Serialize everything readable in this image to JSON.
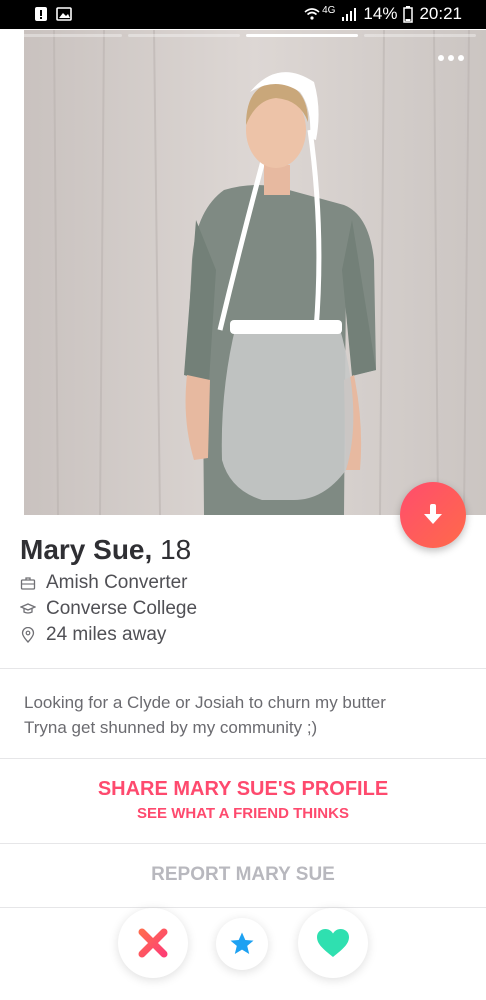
{
  "status_bar": {
    "network": "4G",
    "battery": "14%",
    "time": "20:21",
    "icons": [
      "warning-icon",
      "image-icon",
      "wifi-icon",
      "signal-icon",
      "battery-icon"
    ]
  },
  "photos": {
    "count": 4,
    "active_index": 2,
    "description_icon": "more-icon"
  },
  "profile": {
    "name": "Mary Sue,",
    "age": "18",
    "job": "Amish Converter",
    "school": "Converse College",
    "distance": "24 miles away"
  },
  "bio": {
    "line1": "Looking for a Clyde or Josiah to churn my butter",
    "line2": "Tryna get shunned by my community ;)"
  },
  "share": {
    "title": "SHARE MARY SUE'S PROFILE",
    "subtitle": "SEE WHAT A FRIEND THINKS"
  },
  "report": {
    "label": "REPORT MARY SUE"
  },
  "actions": [
    "nope-icon",
    "super-like-icon",
    "like-icon"
  ],
  "colors": {
    "accent": "#fe4a6e",
    "nope": "#fe4a6e",
    "super_like": "#1da1f2",
    "like": "#2fe0b0"
  }
}
